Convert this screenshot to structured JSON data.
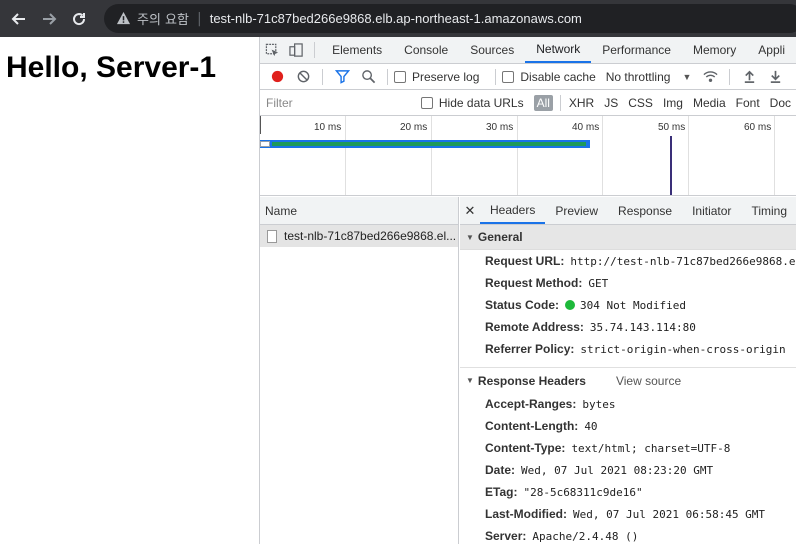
{
  "browser": {
    "security_warning": "주의 요함",
    "url": "test-nlb-71c87bed266e9868.elb.ap-northeast-1.amazonaws.com"
  },
  "page": {
    "heading": "Hello, Server-1"
  },
  "devtools": {
    "tabs": [
      "Elements",
      "Console",
      "Sources",
      "Network",
      "Performance",
      "Memory",
      "Appli"
    ],
    "active_tab": "Network",
    "toolbar": {
      "preserve_log": "Preserve log",
      "disable_cache": "Disable cache",
      "throttling": "No throttling"
    },
    "filter": {
      "placeholder": "Filter",
      "hide_data_urls": "Hide data URLs",
      "types": [
        "All",
        "XHR",
        "JS",
        "CSS",
        "Img",
        "Media",
        "Font",
        "Doc"
      ]
    },
    "overview": {
      "ticks": [
        "10 ms",
        "20 ms",
        "30 ms",
        "40 ms",
        "50 ms",
        "60 ms"
      ]
    },
    "requests": {
      "column_name": "Name",
      "rows": [
        "test-nlb-71c87bed266e9868.el..."
      ]
    },
    "detail": {
      "tabs": [
        "Headers",
        "Preview",
        "Response",
        "Initiator",
        "Timing"
      ],
      "general": {
        "title": "General",
        "request_url_label": "Request URL:",
        "request_url": "http://test-nlb-71c87bed266e9868.el",
        "request_method_label": "Request Method:",
        "request_method": "GET",
        "status_code_label": "Status Code:",
        "status_code": "304 Not Modified",
        "remote_address_label": "Remote Address:",
        "remote_address": "35.74.143.114:80",
        "referrer_policy_label": "Referrer Policy:",
        "referrer_policy": "strict-origin-when-cross-origin"
      },
      "response_headers": {
        "title": "Response Headers",
        "view_source": "View source",
        "items": [
          {
            "k": "Accept-Ranges:",
            "v": "bytes"
          },
          {
            "k": "Content-Length:",
            "v": "40"
          },
          {
            "k": "Content-Type:",
            "v": "text/html; charset=UTF-8"
          },
          {
            "k": "Date:",
            "v": "Wed, 07 Jul 2021 08:23:20 GMT"
          },
          {
            "k": "ETag:",
            "v": "\"28-5c68311c9de16\""
          },
          {
            "k": "Last-Modified:",
            "v": "Wed, 07 Jul 2021 06:58:45 GMT"
          },
          {
            "k": "Server:",
            "v": "Apache/2.4.48 ()"
          }
        ]
      }
    }
  }
}
